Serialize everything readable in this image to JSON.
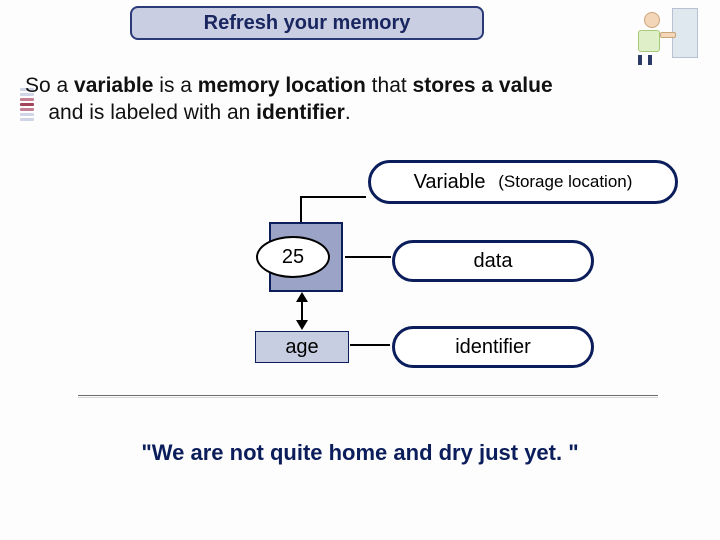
{
  "title": "Refresh your memory",
  "paragraph": {
    "pre": "So a ",
    "b1": "variable",
    "mid1": " is a ",
    "b2": "memory location",
    "mid2": " that ",
    "b3": "stores a value",
    "mid3": " and is labeled with an ",
    "b4": "identifier",
    "end": "."
  },
  "labels": {
    "variable_main": "Variable",
    "variable_sub": "(Storage location)",
    "data": "data",
    "identifier": "identifier"
  },
  "diagram": {
    "value": "25",
    "name": "age"
  },
  "quote": "\"We are not quite home and dry just yet. \""
}
